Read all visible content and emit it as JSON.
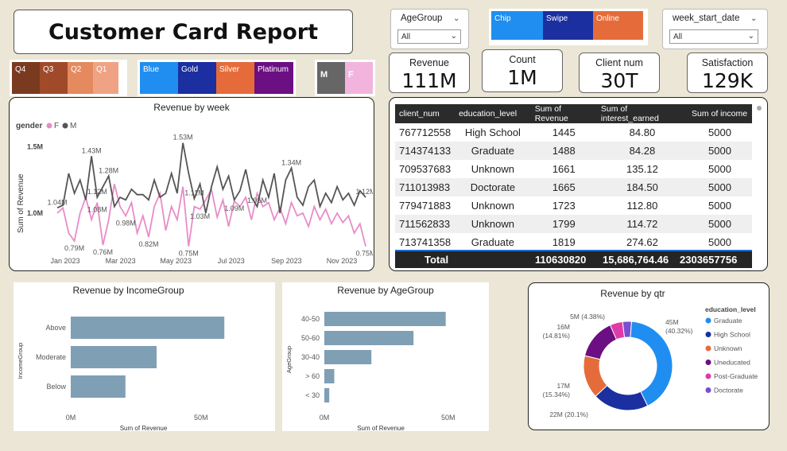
{
  "title": "Customer Card Report",
  "quarter_slicer": [
    "Q4",
    "Q3",
    "Q2",
    "Q1"
  ],
  "quarter_colors": [
    "#7a3a1f",
    "#a04a2a",
    "#e48a5e",
    "#f0a384"
  ],
  "card_slicer": [
    "Blue",
    "Gold",
    "Silver",
    "Platinum"
  ],
  "card_colors": [
    "#1f8ef0",
    "#1b2fa0",
    "#e56c3a",
    "#6b0f82"
  ],
  "gender_slicer": [
    "M",
    "F"
  ],
  "gender_colors": [
    "#666666",
    "#f2b4dd"
  ],
  "txn_slicer": [
    "Chip",
    "Swipe",
    "Online"
  ],
  "txn_colors": [
    "#1f8ef0",
    "#1b2fa0",
    "#e56c3a"
  ],
  "agegroup_filter": {
    "label": "AgeGroup",
    "value": "All"
  },
  "week_filter": {
    "label": "week_start_date",
    "value": "All"
  },
  "kpis": [
    {
      "label": "Revenue",
      "value": "111M"
    },
    {
      "label": "Count",
      "value": "1M"
    },
    {
      "label": "Client num",
      "value": "30T"
    },
    {
      "label": "Satisfaction",
      "value": "129K"
    }
  ],
  "table": {
    "headers": [
      "client_num",
      "education_level",
      "Sum of Revenue",
      "Sum of interest_earned",
      "Sum of income"
    ],
    "rows": [
      [
        "767712558",
        "High School",
        "1445",
        "84.80",
        "5000"
      ],
      [
        "714374133",
        "Graduate",
        "1488",
        "84.28",
        "5000"
      ],
      [
        "709537683",
        "Unknown",
        "1661",
        "135.12",
        "5000"
      ],
      [
        "711013983",
        "Doctorate",
        "1665",
        "184.50",
        "5000"
      ],
      [
        "779471883",
        "Unknown",
        "1723",
        "112.80",
        "5000"
      ],
      [
        "711562833",
        "Unknown",
        "1799",
        "114.72",
        "5000"
      ],
      [
        "713741358",
        "Graduate",
        "1819",
        "274.62",
        "5000"
      ]
    ],
    "total_label": "Total",
    "totals": [
      "110630820",
      "15,686,764.46",
      "2303657756"
    ]
  },
  "chart_data": [
    {
      "type": "line",
      "title": "Revenue by week",
      "legend_title": "gender",
      "xlabel": "",
      "ylabel": "Sum of Revenue",
      "x_ticks": [
        "Jan 2023",
        "Mar 2023",
        "May 2023",
        "Jul 2023",
        "Sep 2023",
        "Nov 2023"
      ],
      "y_ticks": [
        "1.5M",
        "1.0M"
      ],
      "ylim": [
        0.7,
        1.6
      ],
      "series": [
        {
          "name": "M",
          "color": "#555555",
          "values": [
            1.04,
            1.06,
            1.3,
            1.15,
            1.25,
            1.1,
            1.43,
            1.12,
            1.2,
            1.28,
            1.05,
            1.12,
            1.1,
            1.18,
            1.14,
            1.14,
            1.1,
            1.25,
            1.12,
            1.15,
            1.3,
            1.15,
            1.53,
            1.3,
            1.11,
            1.22,
            1.0,
            1.2,
            1.35,
            1.18,
            1.28,
            1.1,
            1.17,
            1.33,
            1.12,
            1.05,
            1.25,
            1.12,
            1.3,
            1.0,
            1.25,
            1.34,
            1.12,
            1.06,
            1.2,
            1.25,
            1.05,
            1.15,
            1.08,
            1.2,
            1.1,
            1.15,
            1.06,
            1.17,
            1.12
          ]
        },
        {
          "name": "F",
          "color": "#e88cc8",
          "values": [
            1.0,
            1.04,
            0.85,
            0.79,
            1.0,
            1.12,
            0.95,
            1.08,
            0.76,
            0.95,
            1.22,
            1.05,
            0.98,
            1.08,
            0.85,
            0.98,
            0.82,
            1.05,
            1.15,
            0.87,
            1.05,
            0.95,
            1.2,
            0.75,
            1.05,
            1.03,
            1.1,
            1.18,
            0.97,
            1.1,
            0.9,
            1.09,
            1.05,
            1.12,
            0.95,
            1.15,
            1.05,
            1.08,
            0.95,
            1.04,
            0.92,
            1.08,
            0.98,
            1.0,
            0.9,
            1.05,
            0.95,
            1.03,
            0.92,
            1.0,
            0.93,
            0.98,
            0.85,
            0.92,
            0.75
          ]
        }
      ],
      "data_labels": [
        {
          "text": "1.43M",
          "series": "M",
          "index": 6
        },
        {
          "text": "1.28M",
          "series": "M",
          "index": 9
        },
        {
          "text": "1.12M",
          "series": "M",
          "index": 7
        },
        {
          "text": "1.04M",
          "series": "M",
          "index": 0
        },
        {
          "text": "1.08M",
          "series": "F",
          "index": 7
        },
        {
          "text": "0.98M",
          "series": "F",
          "index": 12
        },
        {
          "text": "0.79M",
          "series": "F",
          "index": 3
        },
        {
          "text": "0.76M",
          "series": "F",
          "index": 8
        },
        {
          "text": "0.82M",
          "series": "F",
          "index": 16
        },
        {
          "text": "1.53M",
          "series": "M",
          "index": 22
        },
        {
          "text": "1.11M",
          "series": "M",
          "index": 24
        },
        {
          "text": "1.03M",
          "series": "F",
          "index": 25
        },
        {
          "text": "0.75M",
          "series": "F",
          "index": 23
        },
        {
          "text": "1.09M",
          "series": "F",
          "index": 31
        },
        {
          "text": "1.05M",
          "series": "F",
          "index": 35
        },
        {
          "text": "1.34M",
          "series": "M",
          "index": 41
        },
        {
          "text": "1.12M",
          "series": "M",
          "index": 54
        },
        {
          "text": "0.75M",
          "series": "F",
          "index": 54
        }
      ]
    },
    {
      "type": "bar",
      "title": "Revenue by IncomeGroup",
      "xlabel": "Sum of Revenue",
      "ylabel": "IncomeGroup",
      "categories": [
        "Above",
        "Moderate",
        "Below"
      ],
      "values": [
        59,
        33,
        21
      ],
      "xlim": [
        0,
        62
      ],
      "x_ticks": [
        "0M",
        "50M"
      ],
      "color": "#7f9fb5"
    },
    {
      "type": "bar",
      "title": "Revenue by AgeGroup",
      "xlabel": "Sum of Revenue",
      "ylabel": "AgeGroup",
      "categories": [
        "40-50",
        "50-60",
        "30-40",
        "> 60",
        "< 30"
      ],
      "values": [
        49,
        36,
        19,
        4,
        2
      ],
      "xlim": [
        0,
        52
      ],
      "x_ticks": [
        "0M",
        "50M"
      ],
      "color": "#7f9fb5"
    },
    {
      "type": "pie",
      "title": "Revenue by qtr",
      "legend_title": "education_level",
      "categories": [
        "Graduate",
        "High School",
        "Unknown",
        "Uneducated",
        "Post-Graduate",
        "Doctorate"
      ],
      "colors": [
        "#1f8ef0",
        "#1b2fa0",
        "#e56c3a",
        "#6b0f82",
        "#e03aaa",
        "#7b4ed0"
      ],
      "values": [
        45,
        22,
        17,
        16,
        5,
        3.5
      ],
      "data_labels": [
        "45M (40.32%)",
        "22M (20.1%)",
        "17M (15.34%)",
        "16M (14.81%)",
        "5M (4.38%)",
        ""
      ]
    }
  ]
}
